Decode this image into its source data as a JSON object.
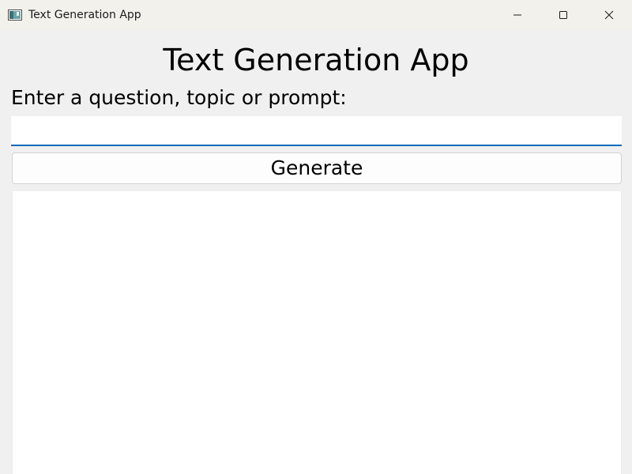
{
  "window": {
    "title": "Text Generation App",
    "icon": "app-window-icon",
    "controls": {
      "minimize_icon": "minimize-icon",
      "maximize_icon": "maximize-icon",
      "close_icon": "close-icon"
    }
  },
  "main": {
    "heading": "Text Generation App",
    "prompt_label": "Enter a question, topic or prompt:",
    "prompt_value": "",
    "generate_label": "Generate",
    "output_text": ""
  },
  "colors": {
    "window_background": "#f0f0f0",
    "titlebar_background": "#f3f1ec",
    "input_focus_accent": "#0f6cbd",
    "output_background": "#ffffff"
  }
}
